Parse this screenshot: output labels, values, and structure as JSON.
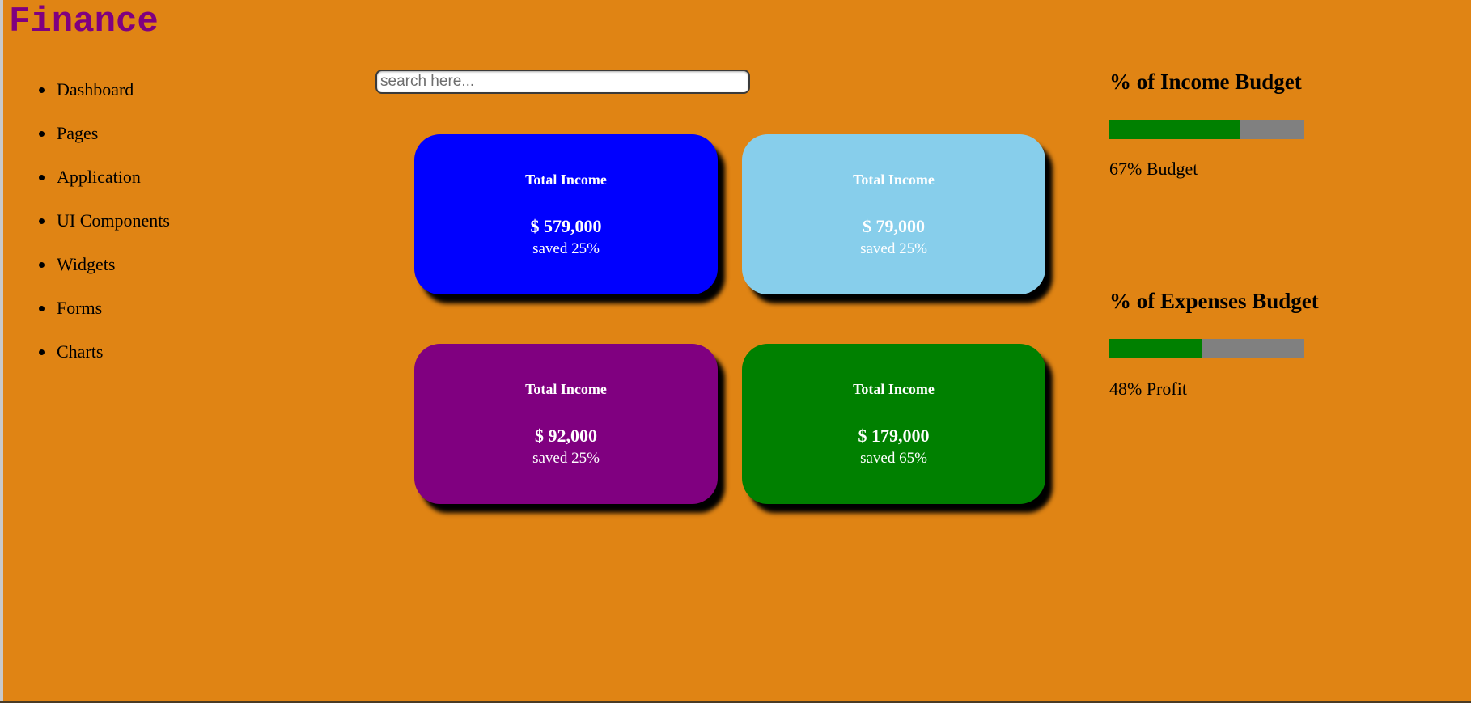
{
  "app": {
    "title": "Finance"
  },
  "sidebar": {
    "items": [
      {
        "label": "Dashboard"
      },
      {
        "label": "Pages"
      },
      {
        "label": "Application"
      },
      {
        "label": "UI Components"
      },
      {
        "label": "Widgets"
      },
      {
        "label": "Forms"
      },
      {
        "label": "Charts"
      }
    ]
  },
  "search": {
    "placeholder": "search here...",
    "value": ""
  },
  "cards": [
    {
      "title": "Total Income",
      "amount": "$ 579,000",
      "saved": "saved 25%",
      "color": "#0000ff"
    },
    {
      "title": "Total Income",
      "amount": "$ 79,000",
      "saved": "saved 25%",
      "color": "#87ceeb"
    },
    {
      "title": "Total Income",
      "amount": "$ 92,000",
      "saved": "saved 25%",
      "color": "#800080"
    },
    {
      "title": "Total Income",
      "amount": "$ 179,000",
      "saved": "saved 65%",
      "color": "#008000"
    }
  ],
  "budgets": {
    "income": {
      "heading": "% of Income Budget",
      "percent": 67,
      "label": "67% Budget"
    },
    "expenses": {
      "heading": "% of Expenses Budget",
      "percent": 48,
      "label": "48% Profit"
    }
  },
  "colors": {
    "page_background": "#e08414",
    "title": "#800080",
    "bar_fill": "#008000",
    "bar_track": "#808080"
  }
}
